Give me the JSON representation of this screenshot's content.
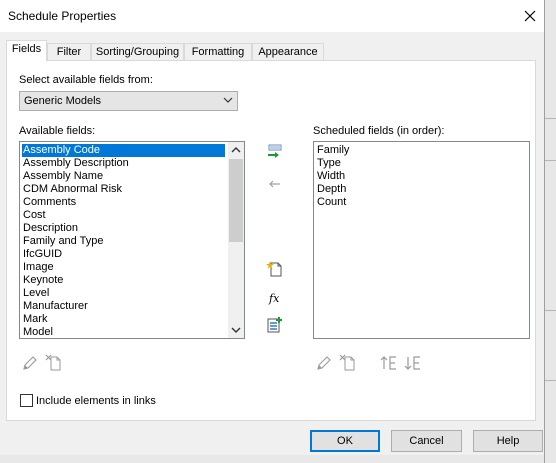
{
  "window": {
    "title": "Schedule Properties"
  },
  "tabs": [
    {
      "label": "Fields"
    },
    {
      "label": "Filter"
    },
    {
      "label": "Sorting/Grouping"
    },
    {
      "label": "Formatting"
    },
    {
      "label": "Appearance"
    }
  ],
  "fields_tab": {
    "select_label": "Select available fields from:",
    "select_value": "Generic Models",
    "available_label": "Available fields:",
    "available_fields": [
      "Assembly Code",
      "Assembly Description",
      "Assembly Name",
      "CDM Abnormal Risk",
      "Comments",
      "Cost",
      "Description",
      "Family and Type",
      "IfcGUID",
      "Image",
      "Keynote",
      "Level",
      "Manufacturer",
      "Mark",
      "Model"
    ],
    "selected_available": "Assembly Code",
    "scheduled_label": "Scheduled fields (in order):",
    "scheduled_fields": [
      "Family",
      "Type",
      "Width",
      "Depth",
      "Count"
    ],
    "include_links_label": "Include elements in links",
    "fx_symbol": "fx"
  },
  "buttons": {
    "ok": "OK",
    "cancel": "Cancel",
    "help": "Help"
  },
  "colors": {
    "accent": "#0078d7",
    "add_arrow": "#1a9a3a"
  }
}
